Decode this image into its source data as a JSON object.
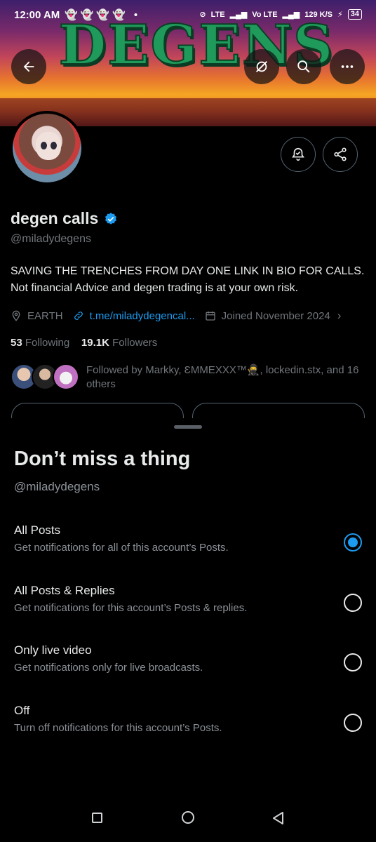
{
  "status_bar": {
    "time": "12:00 AM",
    "notification_icons": "👻👻👻👻 •",
    "network": "LTE",
    "volte": "Vo LTE",
    "speed": "129 K/S",
    "battery": "34"
  },
  "banner": {
    "title": "DEGENS"
  },
  "profile": {
    "name": "degen calls",
    "handle": "@miladydegens",
    "bio": "SAVING THE TRENCHES FROM DAY ONE LINK IN BIO FOR CALLS. Not financial Advice and degen trading is at your own risk.",
    "location": "EARTH",
    "link": "t.me/miladydegencal...",
    "joined": "Joined November 2024",
    "following_count": "53",
    "following_label": "Following",
    "followers_count": "19.1K",
    "followers_label": "Followers",
    "followed_by": "Followed by Markky, ƐMMEXXX™🥷, lockedin.stx, and 16 others"
  },
  "sheet": {
    "title": "Don’t miss a thing",
    "handle": "@miladydegens",
    "options": [
      {
        "title": "All Posts",
        "desc": "Get notifications for all of this account’s Posts.",
        "selected": true
      },
      {
        "title": "All Posts & Replies",
        "desc": "Get notifications for this account’s Posts & replies.",
        "selected": false
      },
      {
        "title": "Only live video",
        "desc": "Get notifications only for live broadcasts.",
        "selected": false
      },
      {
        "title": "Off",
        "desc": "Turn off notifications for this account’s Posts.",
        "selected": false
      }
    ]
  },
  "icons": {
    "back": "back-arrow-icon",
    "grok": "grok-icon",
    "search": "search-icon",
    "more": "more-icon",
    "bell": "bell-check-icon",
    "share": "share-icon",
    "verified": "verified-badge-icon",
    "location": "location-pin-icon",
    "link": "link-icon",
    "calendar": "calendar-icon"
  },
  "colors": {
    "accent": "#1d9bf0",
    "background": "#000000",
    "muted": "#71767b"
  }
}
